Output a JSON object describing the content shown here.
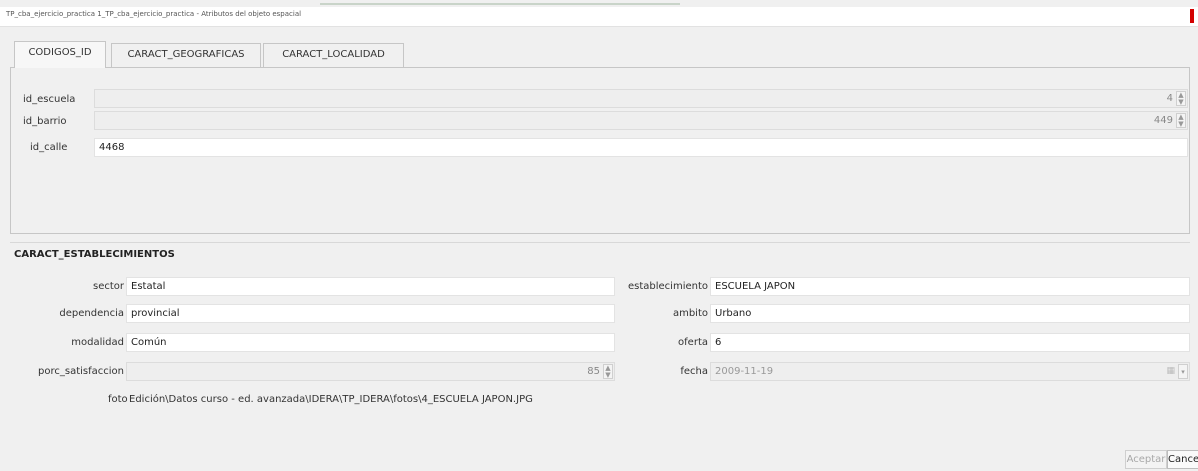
{
  "window": {
    "title": "TP_cba_ejercicio_practica 1_TP_cba_ejercicio_practica - Atributos del objeto espacial"
  },
  "tabs": [
    {
      "label": "CODIGOS_ID",
      "active": true
    },
    {
      "label": "CARACT_GEOGRAFICAS",
      "active": false
    },
    {
      "label": "CARACT_LOCALIDAD",
      "active": false
    }
  ],
  "codigos": {
    "id_escuela": {
      "label": "id_escuela",
      "value": "4"
    },
    "id_barrio": {
      "label": "id_barrio",
      "value": "449"
    },
    "id_calle": {
      "label": "id_calle",
      "value": "4468"
    }
  },
  "section": {
    "title": "CARACT_ESTABLECIMIENTOS",
    "sector": {
      "label": "sector",
      "value": "Estatal"
    },
    "dependencia": {
      "label": "dependencia",
      "value": "provincial"
    },
    "modalidad": {
      "label": "modalidad",
      "value": "Común"
    },
    "porc_satisfaccion": {
      "label": "porc_satisfaccion",
      "value": "85"
    },
    "foto": {
      "label": "foto",
      "value": "Edición\\Datos curso - ed. avanzada\\IDERA\\TP_IDERA\\fotos\\4_ESCUELA JAPON.JPG"
    },
    "establecimiento": {
      "label": "establecimiento",
      "value": "ESCUELA JAPON"
    },
    "ambito": {
      "label": "ambito",
      "value": "Urbano"
    },
    "oferta": {
      "label": "oferta",
      "value": "6"
    },
    "fecha": {
      "label": "fecha",
      "value": "2009-11-19"
    }
  },
  "buttons": {
    "accept": "Aceptar",
    "cancel": "Cancelar"
  },
  "colors": {
    "close_accent": "#d40000",
    "background": "#f0f0f0"
  }
}
